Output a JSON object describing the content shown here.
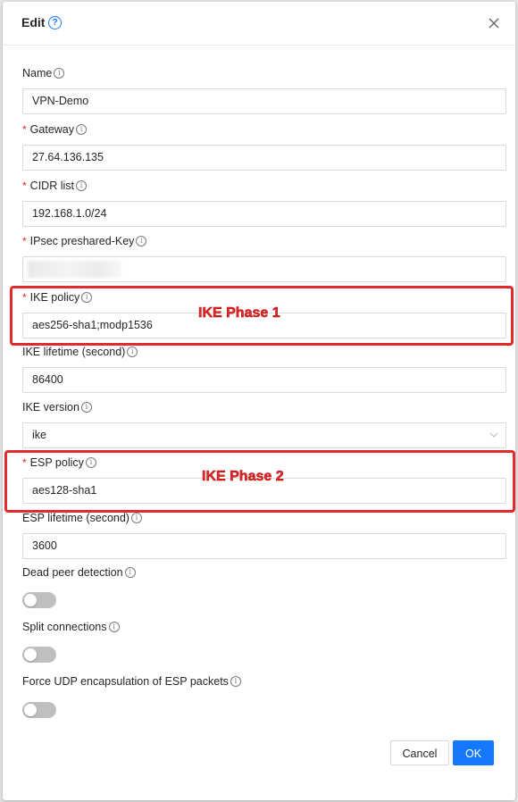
{
  "dialog": {
    "title": "Edit",
    "close_icon": "close-icon",
    "help_icon": "question-circle-icon"
  },
  "fields": {
    "name": {
      "label": "Name",
      "value": "VPN-Demo",
      "required": false
    },
    "gateway": {
      "label": "Gateway",
      "value": "27.64.136.135",
      "required": true
    },
    "cidr_list": {
      "label": "CIDR list",
      "value": "192.168.1.0/24",
      "required": true
    },
    "ipsec_key": {
      "label": "IPsec preshared-Key",
      "value": "",
      "required": true
    },
    "ike_policy": {
      "label": "IKE policy",
      "value": "aes256-sha1;modp1536",
      "required": true
    },
    "ike_lifetime": {
      "label": "IKE lifetime (second)",
      "value": "86400",
      "required": false
    },
    "ike_version": {
      "label": "IKE version",
      "value": "ike",
      "required": false
    },
    "esp_policy": {
      "label": "ESP policy",
      "value": "aes128-sha1",
      "required": true
    },
    "esp_lifetime": {
      "label": "ESP lifetime (second)",
      "value": "3600",
      "required": false
    },
    "dead_peer_detection": {
      "label": "Dead peer detection",
      "enabled": false
    },
    "split_connections": {
      "label": "Split connections",
      "enabled": false
    },
    "force_udp": {
      "label": "Force UDP encapsulation of ESP packets",
      "enabled": false
    }
  },
  "required_marker": "*",
  "info_glyph": "i",
  "buttons": {
    "cancel": "Cancel",
    "ok": "OK"
  },
  "annotations": {
    "phase1": "IKE Phase 1",
    "phase2": "IKE Phase 2",
    "color": "#e32b2b"
  },
  "colors": {
    "primary": "#1677ff",
    "required": "#e02020",
    "toggle_off": "#bfbfbf"
  }
}
